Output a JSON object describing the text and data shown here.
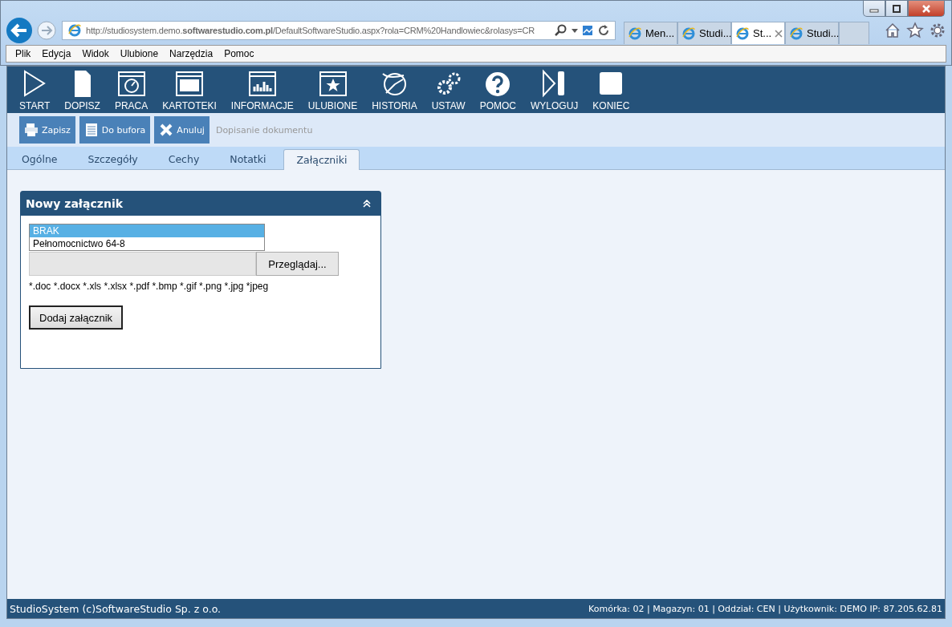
{
  "browser": {
    "address": "http://studiosystem.demo.**softwarestudio.com.pl**/DefaultSoftwareStudio.aspx?rola=CRM%20Handlowiec&rolasys=CR",
    "tabs": [
      {
        "label": "Men...",
        "selected": false
      },
      {
        "label": "Studi...",
        "selected": false
      },
      {
        "label": "St...",
        "selected": true
      },
      {
        "label": "Studi...",
        "selected": false
      }
    ],
    "menu": [
      "Plik",
      "Edycja",
      "Widok",
      "Ulubione",
      "Narzędzia",
      "Pomoc"
    ]
  },
  "toolbar": [
    "START",
    "DOPISZ",
    "PRACA",
    "KARTOTEKI",
    "INFORMACJE",
    "ULUBIONE",
    "HISTORIA",
    "USTAW",
    "POMOC",
    "WYLOGUJ",
    "KONIEC"
  ],
  "actions": [
    "Zapisz",
    "Do bufora",
    "Anuluj"
  ],
  "page_title": "Dopisanie dokumentu",
  "tabs": [
    {
      "label": "Ogólne",
      "selected": false
    },
    {
      "label": "Szczegóły",
      "selected": false
    },
    {
      "label": "Cechy",
      "selected": false
    },
    {
      "label": "Notatki",
      "selected": false
    },
    {
      "label": "Załączniki",
      "selected": true
    }
  ],
  "panel": {
    "title": "Nowy załącznik",
    "expanded": true,
    "list": [
      {
        "label": "BRAK",
        "selected": true
      },
      {
        "label": "Pełnomocnictwo 64-8",
        "selected": false
      }
    ],
    "browse_button": "Przeglądaj...",
    "extensions": "*.doc *.docx *.xls *.xlsx *.pdf *.bmp *.gif *.png *.jpg *jpeg",
    "add_button": "Dodaj załącznik"
  },
  "status_bar": {
    "left": "StudioSystem (c)SoftwareStudio Sp. z o.o.",
    "right": "Komórka: 02 | Magazyn: 01 | Oddział: CEN | Użytkownik: DEMO IP: 87.205.62.81"
  }
}
